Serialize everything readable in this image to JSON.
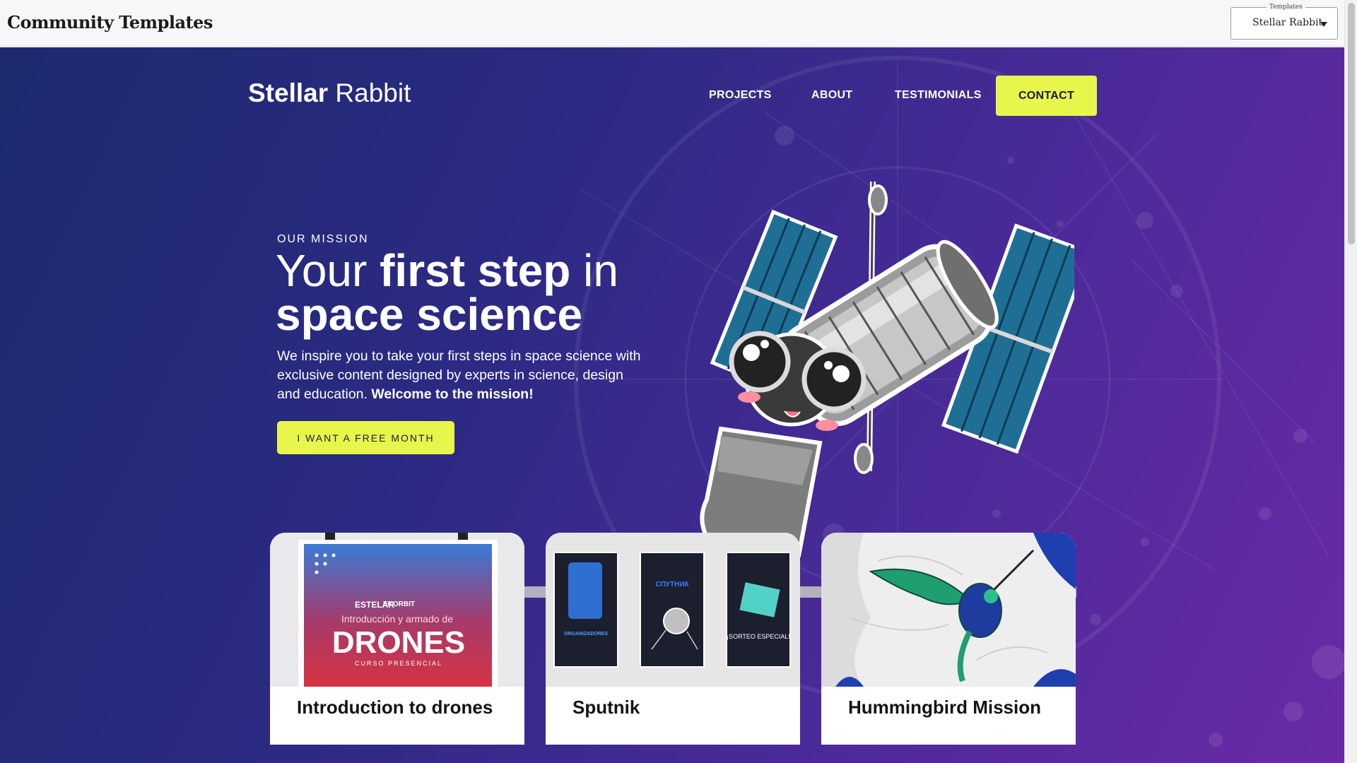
{
  "topbar": {
    "logo": "Community Templates",
    "template_legend": "Templates",
    "template_value": "Stellar Rabbit"
  },
  "site": {
    "brand_bold": "Stellar",
    "brand_light": "Rabbit",
    "nav": [
      "PROJECTS",
      "ABOUT",
      "TESTIMONIALS",
      "CONTACT"
    ]
  },
  "hero": {
    "kicker": "OUR MISSION",
    "headline_1": "Your ",
    "headline_2": "first step",
    "headline_3": " in",
    "headline_4": "space science",
    "desc": "We inspire you to take your first steps in space science with exclusive content designed by experts in science, design and education. ",
    "desc_bold": "Welcome to the mission!",
    "cta": "I WANT A FREE MONTH"
  },
  "cards": [
    {
      "title": "Introduction to drones",
      "poster": {
        "org1": "ESTELAR",
        "org2": "EKORBIT",
        "subtitle": "Introducción y armado de",
        "title": "DRONES",
        "tag": "CURSO PRESENCIAL"
      }
    },
    {
      "title": "Sputnik",
      "poster": {
        "l1": "ORGANIZADORES",
        "l2": "CПУTНИК",
        "l3": "¡SORTEO ESPECIAL!"
      }
    },
    {
      "title": "Hummingbird Mission"
    }
  ],
  "colors": {
    "accent": "#e8f54a",
    "hero_start": "#1d2a6f",
    "hero_end": "#6a2aa6"
  }
}
